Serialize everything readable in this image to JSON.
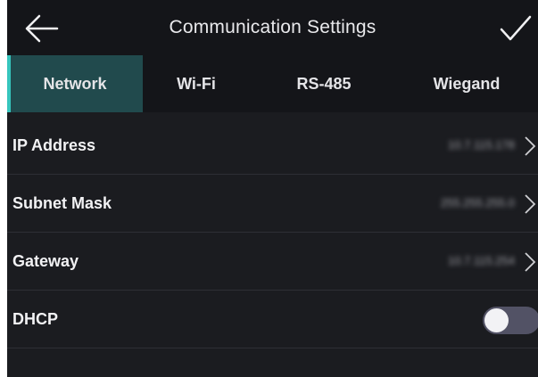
{
  "header": {
    "title": "Communication Settings",
    "back_icon": "arrow-left-icon",
    "confirm_icon": "checkmark-icon"
  },
  "tabs": [
    {
      "label": "Network",
      "active": true
    },
    {
      "label": "Wi-Fi",
      "active": false
    },
    {
      "label": "RS-485",
      "active": false
    },
    {
      "label": "Wiegand",
      "active": false
    }
  ],
  "rows": {
    "ip_address": {
      "label": "IP Address",
      "value": "10.7.115.178"
    },
    "subnet_mask": {
      "label": "Subnet Mask",
      "value": "255.255.255.0"
    },
    "gateway": {
      "label": "Gateway",
      "value": "10.7.115.254"
    },
    "dhcp": {
      "label": "DHCP",
      "enabled": false
    }
  },
  "colors": {
    "background": "#1b1c20",
    "active_tab": "#214a4d",
    "accent": "#36c5bd",
    "toggle_off": "#525265"
  }
}
